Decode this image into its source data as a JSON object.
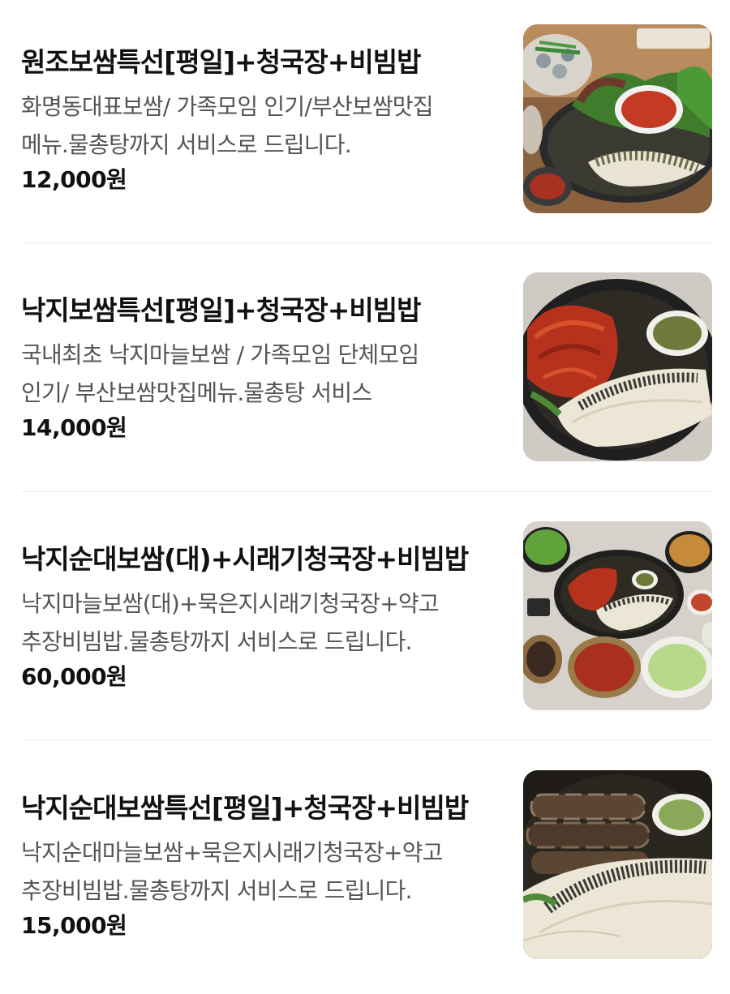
{
  "menu": {
    "items": [
      {
        "name": "원조보쌈특선[평일]+청국장+비빔밥",
        "desc_line1": "화명동대표보쌈/ 가족모임 인기/부산보쌈맛집",
        "desc_line2": "메뉴.물총탕까지 서비스로 드립니다.",
        "price": "12,000원"
      },
      {
        "name": "낙지보쌈특선[평일]+청국장+비빔밥",
        "desc_line1": "국내최초 낙지마늘보쌈 / 가족모임 단체모임",
        "desc_line2": "인기/ 부산보쌈맛집메뉴.물총탕 서비스",
        "price": "14,000원"
      },
      {
        "name": "낙지순대보쌈(대)+시래기청국장+비빔밥",
        "desc_line1": "낙지마늘보쌈(대)+묵은지시래기청국장+약고",
        "desc_line2": "추장비빔밥.물총탕까지 서비스로 드립니다.",
        "price": "60,000원"
      },
      {
        "name": "낙지순대보쌈특선[평일]+청국장+비빔밥",
        "desc_line1": "낙지순대마늘보쌈+묵은지시래기청국장+약고",
        "desc_line2": "추장비빔밥.물총탕까지 서비스로 드립니다.",
        "price": "15,000원"
      }
    ]
  },
  "colors": {
    "text_primary": "#111111",
    "text_secondary": "#555555",
    "divider": "#ececec"
  }
}
